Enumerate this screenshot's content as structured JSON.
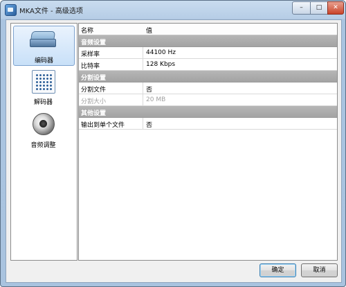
{
  "window": {
    "title": "MKA文件 - 高级选项"
  },
  "controls": {
    "minimize": "–",
    "maximize": "□",
    "close": "✕"
  },
  "sidebar": {
    "items": [
      {
        "label": "编码器",
        "icon": "encoder-icon",
        "selected": true
      },
      {
        "label": "解码器",
        "icon": "decoder-icon",
        "selected": false
      },
      {
        "label": "音频调整",
        "icon": "audio-adjust-icon",
        "selected": false
      }
    ]
  },
  "grid": {
    "headers": {
      "name": "名称",
      "value": "值"
    },
    "rows": [
      {
        "type": "category",
        "label": "音频设置"
      },
      {
        "type": "prop",
        "name": "采样率",
        "value": "44100 Hz"
      },
      {
        "type": "prop",
        "name": "比特率",
        "value": "128 Kbps"
      },
      {
        "type": "category",
        "label": "分割设置"
      },
      {
        "type": "prop",
        "name": "分割文件",
        "value": "否"
      },
      {
        "type": "prop",
        "name": "分割大小",
        "value": "20 MB",
        "disabled": true
      },
      {
        "type": "category",
        "label": "其他设置"
      },
      {
        "type": "prop",
        "name": "输出到单个文件",
        "value": "否"
      }
    ]
  },
  "buttons": {
    "ok": "确定",
    "cancel": "取消"
  }
}
